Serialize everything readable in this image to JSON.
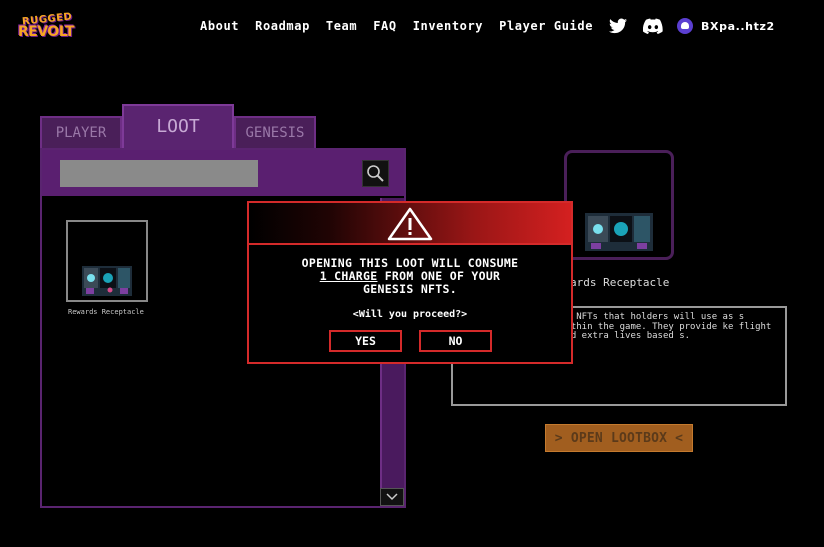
{
  "brand": {
    "logo_line1": "RUGGED",
    "logo_line2": "REVOLT"
  },
  "nav": {
    "items": [
      "About",
      "Roadmap",
      "Team",
      "FAQ",
      "Inventory",
      "Player Guide"
    ],
    "wallet_label": "BXpa..htz2"
  },
  "tabs": {
    "player": "PLAYER",
    "loot": "LOOT",
    "genesis": "GENESIS"
  },
  "inventory": {
    "search_placeholder": "",
    "items": [
      {
        "label": "Rewards Receptacle"
      }
    ]
  },
  "detail": {
    "name": "ards Receptacle",
    "description": "re NFTs that holders will use as s within the game. They provide ke flight and extra lives based s.",
    "open_button": "OPEN LOOTBOX"
  },
  "modal": {
    "line1": "OPENING THIS LOOT WILL CONSUME",
    "line2_em": "1 CHARGE",
    "line2_rest": " FROM ONE OF YOUR",
    "line3": "GENESIS NFTS.",
    "question": "<Will you proceed?>",
    "yes": "YES",
    "no": "NO"
  },
  "colors": {
    "accent_purple": "#5a2470",
    "danger_red": "#d42a2a",
    "open_button": "#a15e1f"
  },
  "icons": [
    "twitter-icon",
    "discord-icon",
    "search-icon",
    "warning-icon",
    "chevron-down-icon"
  ]
}
